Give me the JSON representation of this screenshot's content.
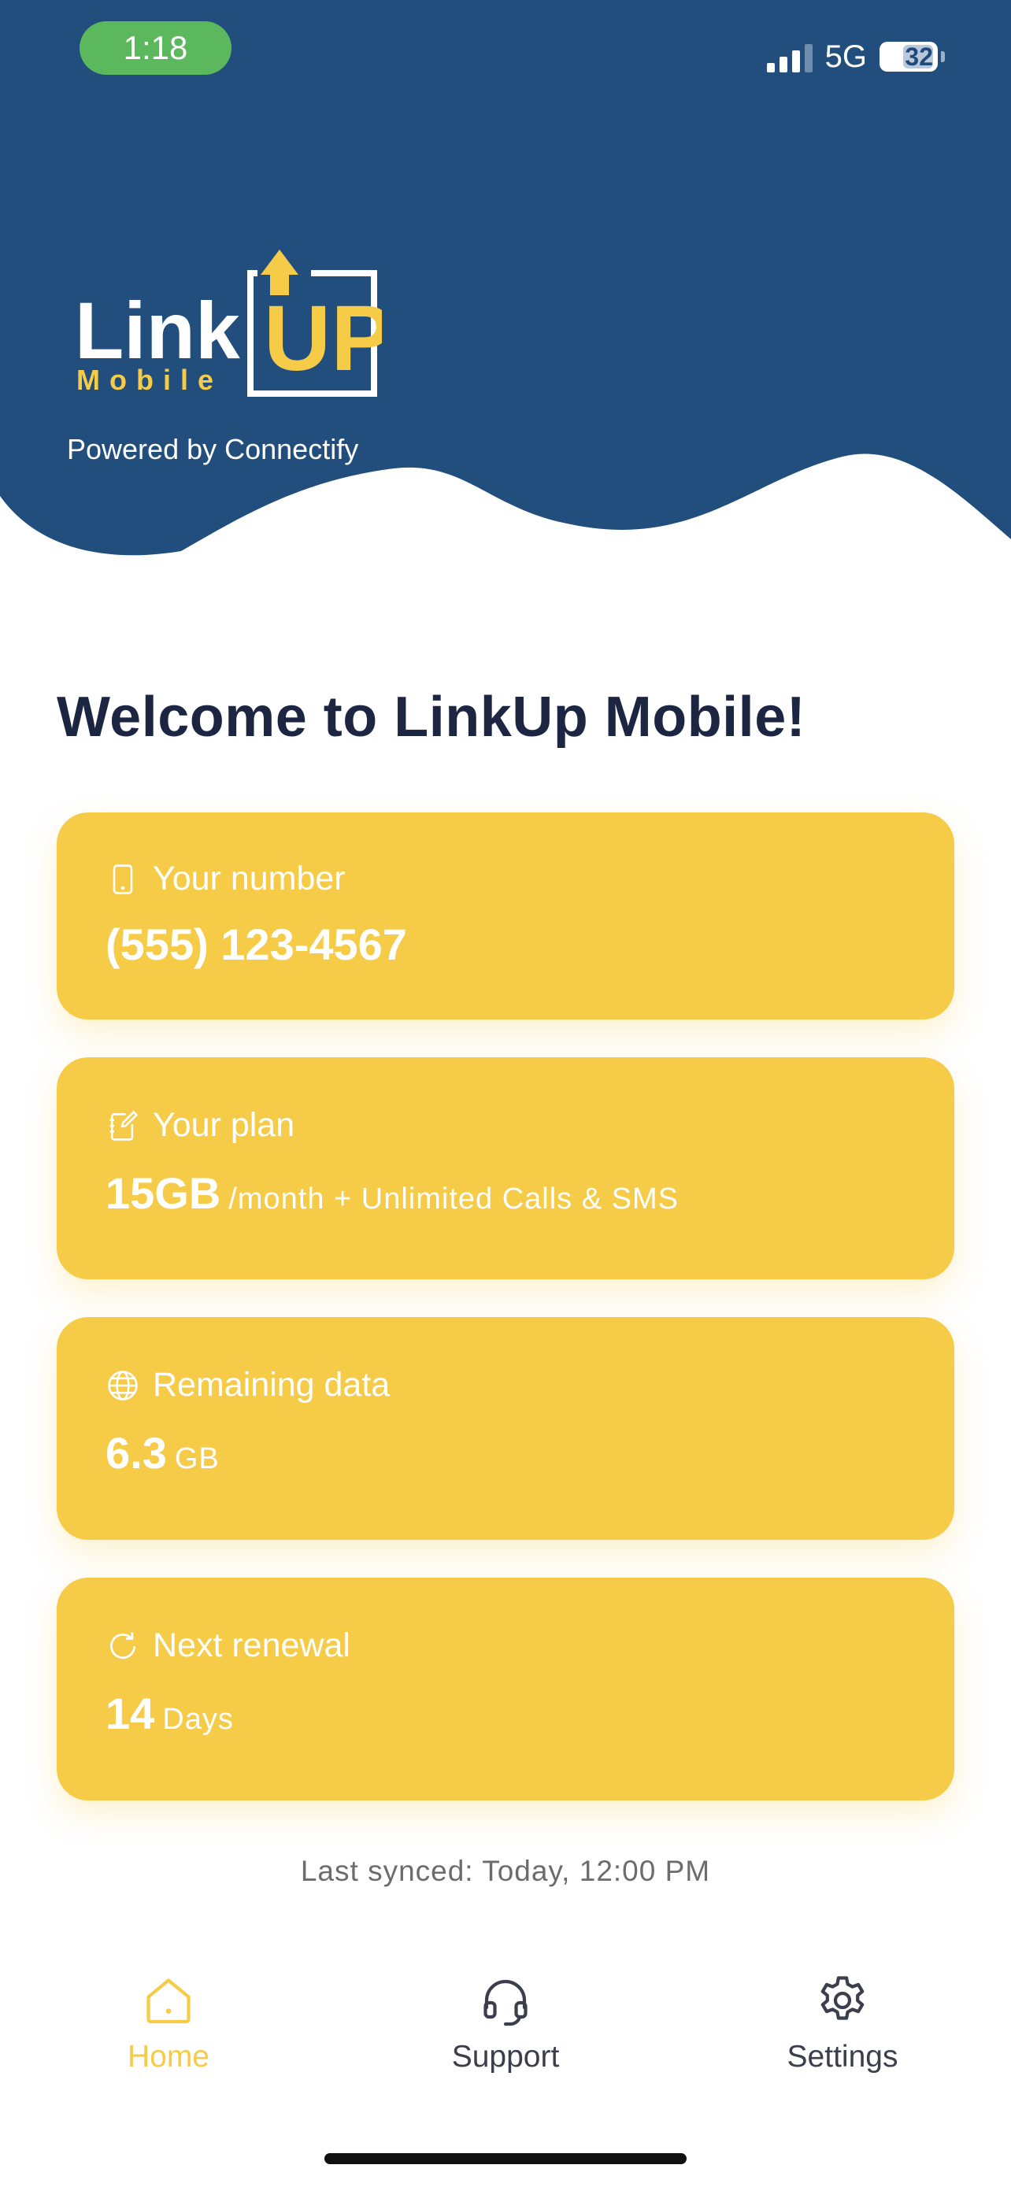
{
  "status_bar": {
    "time": "1:18",
    "network": "5G",
    "battery": "32"
  },
  "brand": {
    "logo_word_1": "Link",
    "logo_word_2": "UP",
    "logo_sub": "Mobile",
    "powered_by": "Powered by Connectify"
  },
  "colors": {
    "header_blue": "#214e7c",
    "card_yellow": "#f5cb47",
    "title_navy": "#1c2541",
    "tab_active": "#f5cb47"
  },
  "welcome_title": "Welcome to LinkUp Mobile!",
  "cards": [
    {
      "icon": "phone-icon",
      "label": "Your number",
      "value": "(555) 123-4567",
      "unit": ""
    },
    {
      "icon": "plan-edit-icon",
      "label": "Your plan",
      "value": "15GB",
      "unit": "/month + Unlimited Calls & SMS"
    },
    {
      "icon": "globe-icon",
      "label": "Remaining data",
      "value": "6.3",
      "unit": "GB"
    },
    {
      "icon": "refresh-icon",
      "label": "Next renewal",
      "value": "14",
      "unit": "Days"
    }
  ],
  "last_synced": "Last synced: Today, 12:00 PM",
  "tabs": [
    {
      "icon": "home-icon",
      "label": "Home",
      "active": true
    },
    {
      "icon": "headset-icon",
      "label": "Support",
      "active": false
    },
    {
      "icon": "gear-icon",
      "label": "Settings",
      "active": false
    }
  ]
}
